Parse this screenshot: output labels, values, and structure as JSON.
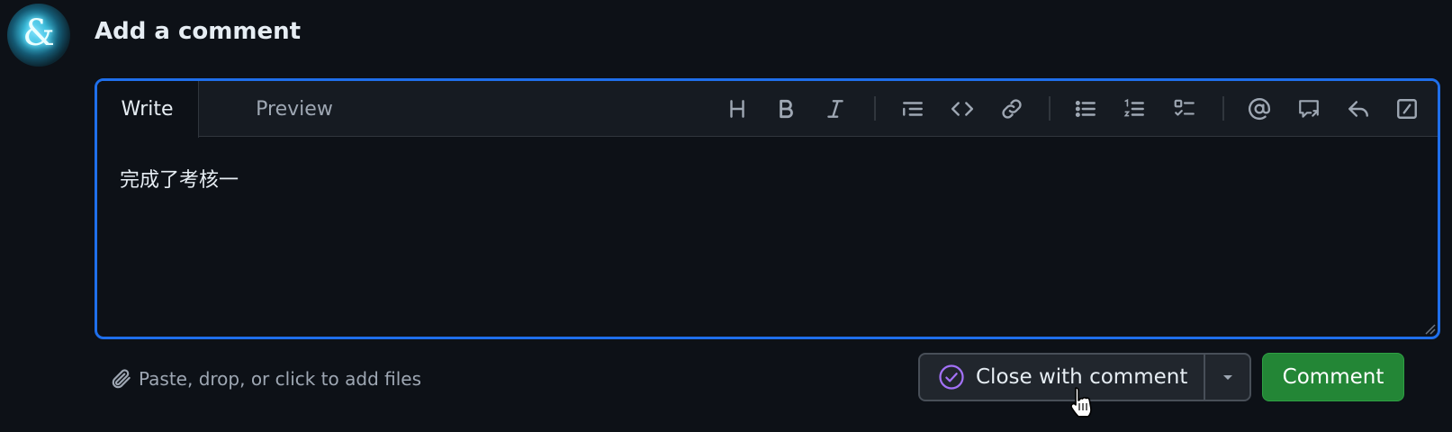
{
  "heading": "Add a comment",
  "avatar_glyph": "&",
  "editor": {
    "tabs": {
      "write": "Write",
      "preview": "Preview"
    },
    "active_tab": "Write",
    "toolbar_icons": [
      "heading-icon",
      "bold-icon",
      "italic-icon",
      "quote-icon",
      "code-icon",
      "link-icon",
      "unordered-list-icon",
      "ordered-list-icon",
      "task-list-icon",
      "mention-icon",
      "reference-icon",
      "saved-reply-icon",
      "slash-command-icon"
    ],
    "text": "完成了考核一"
  },
  "attach_text": "Paste, drop, or click to add files",
  "buttons": {
    "close_with_comment": "Close with comment",
    "comment": "Comment"
  },
  "colors": {
    "background": "#0d1117",
    "focus_border": "#1f6feb",
    "comment_green": "#238636",
    "close_icon_purple": "#a371f7"
  }
}
